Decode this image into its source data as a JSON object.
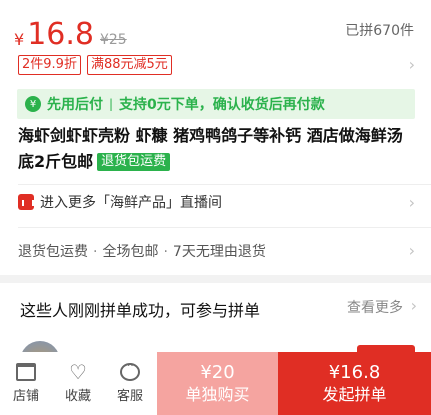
{
  "product": {
    "currency": "¥",
    "price": "16.8",
    "original_price": "¥25",
    "joined": "已拼670件",
    "tags": [
      "2件9.9折",
      "满88元减5元"
    ],
    "promo": {
      "left": "先用后付",
      "separator": "|",
      "right": "支持0元下单，确认收货后再付款"
    },
    "title": "海虾剑虾虾壳粉 虾糠 猪鸡鸭鸽子等补钙 酒店做海鲜汤底2斤包邮",
    "return_badge": "退货包运费",
    "live": "进入更多「海鲜产品」直播间",
    "services": [
      "退货包运费",
      "全场包邮",
      "7天无理由退货"
    ],
    "service_dot": "·"
  },
  "group": {
    "title": "这些人刚刚拼单成功，可参与拼单",
    "see_more": "查看更多"
  },
  "bottom_bar": {
    "store": "店铺",
    "favorite": "收藏",
    "service": "客服",
    "buy_alone_price": "¥20",
    "buy_alone_label": "单独购买",
    "buy_group_price": "¥16.8",
    "buy_group_label": "发起拼单"
  },
  "colors": {
    "accent": "#e02e24",
    "green": "#2bb24c"
  }
}
